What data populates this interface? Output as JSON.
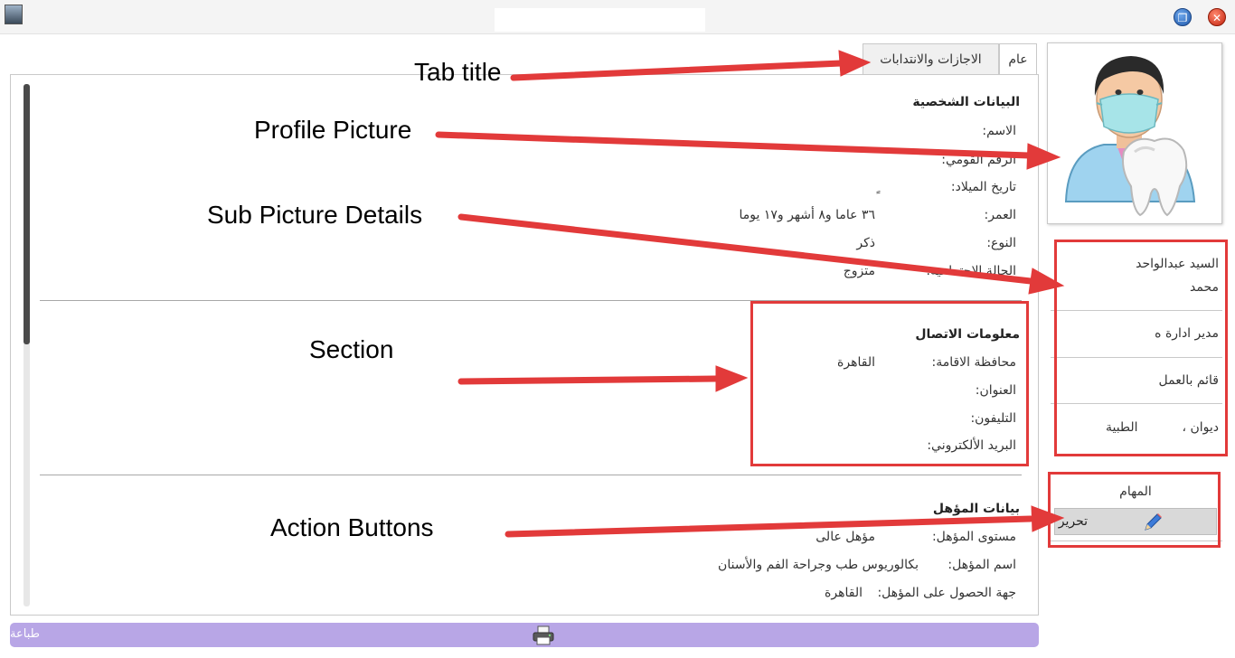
{
  "tabs": {
    "general": "عام",
    "leaves": "الاجازات والانتدابات"
  },
  "personal": {
    "title": "البيانات الشخصية",
    "rows": [
      {
        "label": "الاسم:",
        "value": ""
      },
      {
        "label": "الرقم القومي:",
        "value": ""
      },
      {
        "label": "تاريخ الميلاد:",
        "value": "ٍ"
      },
      {
        "label": "العمر:",
        "value": "٣٦ عاما و٨ أشهر و١٧ يوما"
      },
      {
        "label": "النوع:",
        "value": "ذكر"
      },
      {
        "label": "الحالة الاجتماعية:",
        "value": "متزوج"
      }
    ]
  },
  "contact": {
    "title": "معلومات الاتصال",
    "rows": [
      {
        "label": "محافظة الاقامة:",
        "value": "القاهرة"
      },
      {
        "label": "العنوان:",
        "value": ""
      },
      {
        "label": "التليفون:",
        "value": ""
      },
      {
        "label": "البريد الألكتروني:",
        "value": ""
      }
    ]
  },
  "qualification": {
    "title": "بيانات المؤهل",
    "rows": [
      {
        "label": "مستوى المؤهل:",
        "value": "مؤهل عالى"
      },
      {
        "label": "اسم المؤهل:",
        "value": "بكالوريوس طب وجراحة الفم والأسنان"
      },
      {
        "label": "جهة الحصول على المؤهل:",
        "value": "القاهرة"
      }
    ]
  },
  "profile": {
    "name_line1": "السيد عبدالواحد",
    "name_line2": "محمد",
    "position": "مدير ادارة ه",
    "status": "قائم بالعمل",
    "department_a": "ديوان ،",
    "department_b": "الطبية"
  },
  "tasks": {
    "title": "المهام",
    "edit_label": "تحرير"
  },
  "bottom": {
    "print_label": "طباعة"
  },
  "annotations": {
    "tab_title": "Tab title",
    "profile_picture": "Profile Picture",
    "sub_picture_details": "Sub Picture Details",
    "section": "Section",
    "action_buttons": "Action Buttons"
  },
  "colors": {
    "annotation": "#e23a3a",
    "bottom_bar": "#b8a6e6"
  }
}
